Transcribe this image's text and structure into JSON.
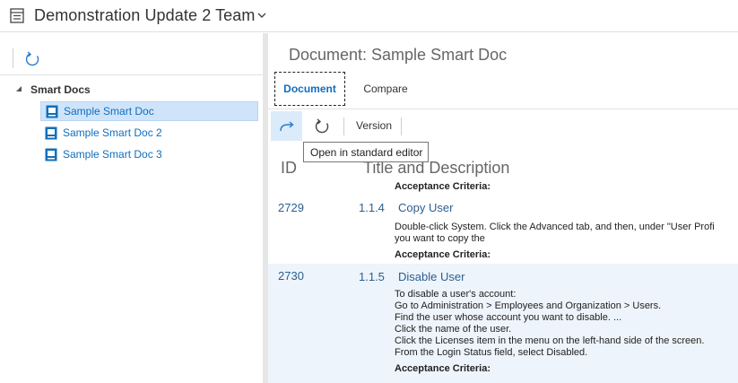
{
  "header": {
    "team_title": "Demonstration Update 2 Team",
    "team_icon": "board-icon",
    "chevron_icon": "chevron-down-icon"
  },
  "left_pane": {
    "refresh_icon": "refresh-icon",
    "tree": {
      "root_label": "Smart Docs",
      "items": [
        {
          "label": "Sample Smart Doc",
          "selected": true
        },
        {
          "label": "Sample Smart Doc 2",
          "selected": false
        },
        {
          "label": "Sample Smart Doc 3",
          "selected": false
        }
      ]
    }
  },
  "main": {
    "doc_title": "Document: Sample Smart Doc",
    "tabs": [
      {
        "label": "Document",
        "active": true
      },
      {
        "label": "Compare",
        "active": false
      }
    ],
    "toolbar": {
      "open_icon": "redo-arrow-icon",
      "refresh_icon": "refresh-icon",
      "version_label": "Version",
      "tooltip": "Open in standard editor"
    },
    "columns": {
      "id": "ID",
      "title": "Title and Description"
    },
    "top_criteria": "Acceptance Criteria:",
    "rows": [
      {
        "id": "2729",
        "number": "1.1.4",
        "title": "Copy User",
        "description": [
          "Double-click System. Click the Advanced tab, and then, under \"User Profi",
          "you want to copy the"
        ],
        "criteria": "Acceptance Criteria:"
      },
      {
        "id": "2730",
        "number": "1.1.5",
        "title": "Disable User",
        "description": [
          "To disable a user's account:",
          "Go to Administration > Employees and Organization > Users.",
          "Find the user whose account you want to disable. ...",
          "Click the name of the user.",
          "Click the Licenses item in the menu on the left-hand side of the screen.",
          "From the Login Status field, select Disabled."
        ],
        "criteria": "Acceptance Criteria:"
      }
    ]
  },
  "colors": {
    "accent": "#106ebe",
    "selected_bg": "#cfe4fa",
    "row_highlight": "#eef4fb"
  }
}
